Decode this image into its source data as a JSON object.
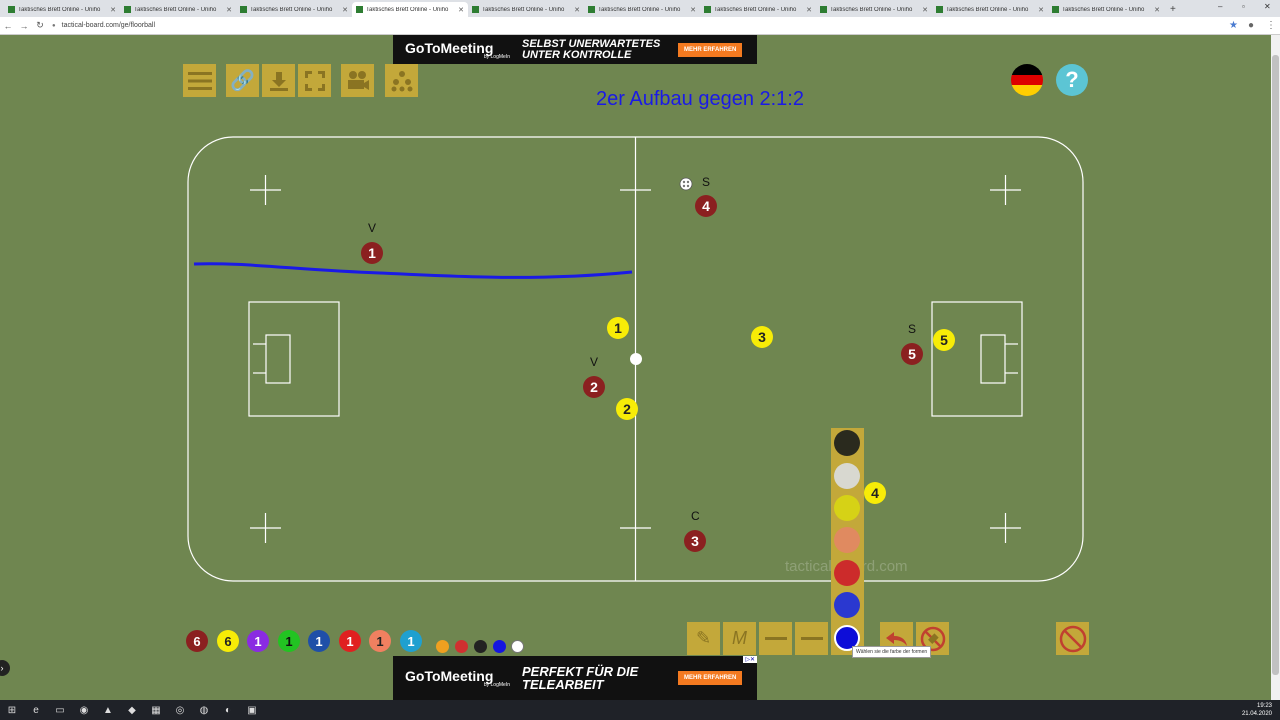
{
  "browser": {
    "tabs": [
      {
        "label": "Taktisches Brett Online - Uniho",
        "active": false
      },
      {
        "label": "Taktisches Brett Online - Uniho",
        "active": false
      },
      {
        "label": "Taktisches Brett Online - Uniho",
        "active": false
      },
      {
        "label": "Taktisches Brett Online - Uniho",
        "active": true
      },
      {
        "label": "Taktisches Brett Online - Uniho",
        "active": false
      },
      {
        "label": "Taktisches Brett Online - Uniho",
        "active": false
      },
      {
        "label": "Taktisches Brett Online - Uniho",
        "active": false
      },
      {
        "label": "Taktisches Brett Online - Uniho",
        "active": false
      },
      {
        "label": "Taktisches Brett Online - Uniho",
        "active": false
      },
      {
        "label": "Taktisches Brett Online - Uniho",
        "active": false
      }
    ],
    "url": "tactical-board.com/ge/floorball"
  },
  "ads": {
    "top": {
      "brand": "GoToMeeting",
      "by": "by LogMeIn",
      "headline": "SELBST UNERWARTETES UNTER KONTROLLE",
      "cta": "MEHR ERFAHREN"
    },
    "bottom": {
      "brand": "GoToMeeting",
      "by": "by LogMeIn",
      "headline": "PERFEKT FÜR DIE TELEARBEIT",
      "cta": "MEHR ERFAHREN"
    }
  },
  "board": {
    "title": "2er Aufbau gegen 2:1:2",
    "watermark": "tactical-board.com",
    "players": [
      {
        "team": "red",
        "number": "1",
        "label": "V"
      },
      {
        "team": "red",
        "number": "2",
        "label": "V"
      },
      {
        "team": "red",
        "number": "3",
        "label": "C"
      },
      {
        "team": "red",
        "number": "4",
        "label": "S"
      },
      {
        "team": "red",
        "number": "5",
        "label": "S"
      },
      {
        "team": "yellow",
        "number": "1"
      },
      {
        "team": "yellow",
        "number": "2"
      },
      {
        "team": "yellow",
        "number": "3"
      },
      {
        "team": "yellow",
        "number": "4"
      },
      {
        "team": "yellow",
        "number": "5"
      }
    ]
  },
  "palette": {
    "tokens": [
      {
        "number": "6",
        "color": "#8b2020"
      },
      {
        "number": "6",
        "color": "#f7ec07"
      },
      {
        "number": "1",
        "color": "#8a2be2"
      },
      {
        "number": "1",
        "color": "#22c322"
      },
      {
        "number": "1",
        "color": "#1f4fa8"
      },
      {
        "number": "1",
        "color": "#e02020"
      },
      {
        "number": "1",
        "color": "#f08060"
      },
      {
        "number": "1",
        "color": "#1fa0d0"
      }
    ],
    "dots": [
      "#f0a020",
      "#d03030",
      "#222222",
      "#1515e0",
      "#ffffff"
    ]
  },
  "colors": {
    "swatches": [
      "#2a2a1e",
      "#d8d8d0",
      "#d6d216",
      "#e08a60",
      "#cc2b2b",
      "#2a38d0",
      "#0d0dd8"
    ],
    "tooltip": "Wählen sie die farbe der formen"
  },
  "tools": {
    "m_label": "M"
  },
  "clock": {
    "time": "19:23",
    "date": "21.04.2020"
  }
}
